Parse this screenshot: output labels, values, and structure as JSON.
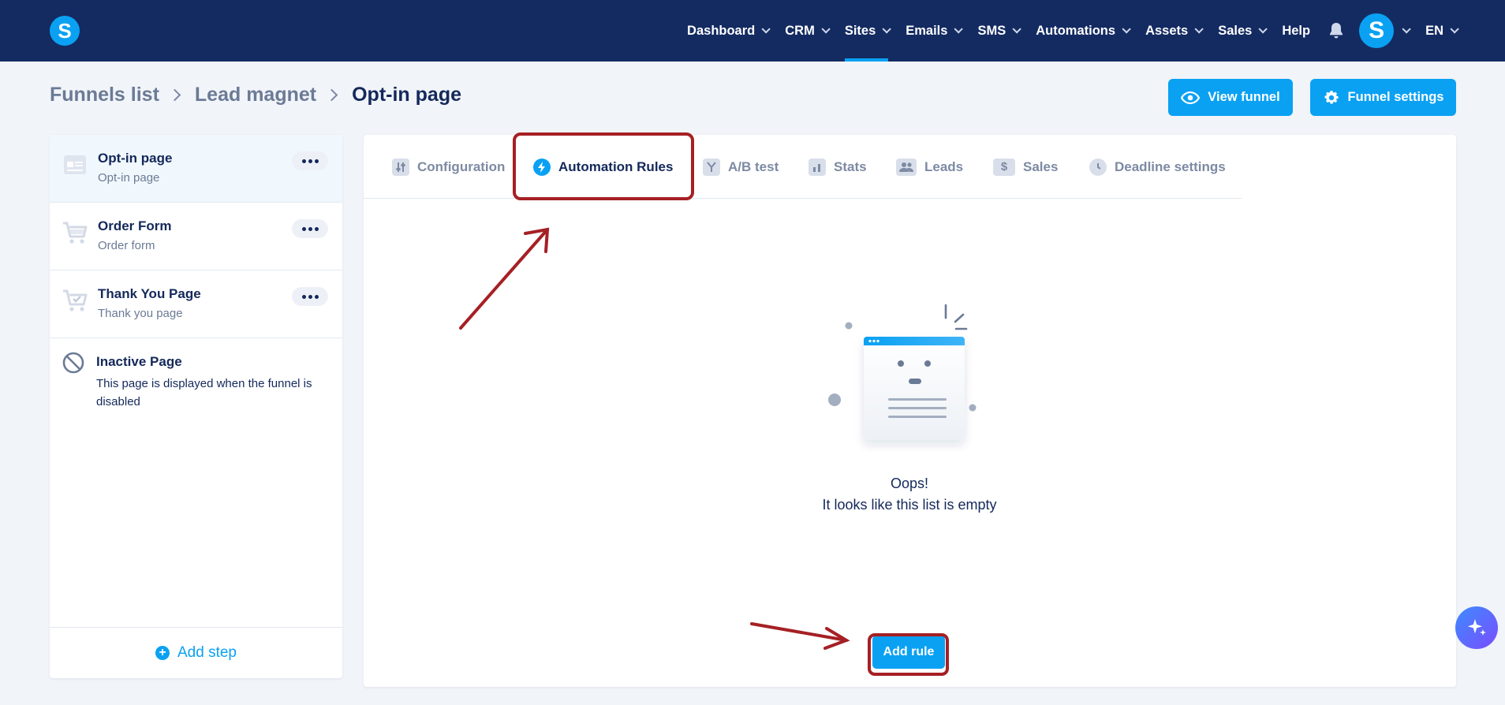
{
  "topnav": {
    "logo_letter": "S",
    "items": [
      {
        "label": "Dashboard",
        "dropdown": true
      },
      {
        "label": "CRM",
        "dropdown": true
      },
      {
        "label": "Sites",
        "dropdown": true,
        "active": true
      },
      {
        "label": "Emails",
        "dropdown": true
      },
      {
        "label": "SMS",
        "dropdown": true
      },
      {
        "label": "Automations",
        "dropdown": true
      },
      {
        "label": "Assets",
        "dropdown": true
      },
      {
        "label": "Sales",
        "dropdown": true
      },
      {
        "label": "Help",
        "dropdown": false
      }
    ],
    "avatar_letter": "S",
    "language": "EN"
  },
  "breadcrumb": {
    "items": [
      "Funnels list",
      "Lead magnet"
    ],
    "current": "Opt-in page"
  },
  "header_buttons": {
    "view_funnel": "View funnel",
    "funnel_settings": "Funnel settings"
  },
  "steps": {
    "items": [
      {
        "title": "Opt-in page",
        "subtitle": "Opt-in page",
        "icon": "page-icon"
      },
      {
        "title": "Order Form",
        "subtitle": "Order form",
        "icon": "cart-icon"
      },
      {
        "title": "Thank You Page",
        "subtitle": "Thank you page",
        "icon": "cart-check-icon"
      }
    ],
    "inactive": {
      "title": "Inactive Page",
      "description": "This page is displayed when the funnel is disabled"
    },
    "add_step": "Add step"
  },
  "tabs": [
    {
      "label": "Configuration",
      "icon": "sliders-icon"
    },
    {
      "label": "Automation Rules",
      "icon": "bolt-icon",
      "active": true
    },
    {
      "label": "A/B test",
      "icon": "split-icon"
    },
    {
      "label": "Stats",
      "icon": "bar-chart-icon"
    },
    {
      "label": "Leads",
      "icon": "users-icon"
    },
    {
      "label": "Sales",
      "icon": "dollar-icon"
    },
    {
      "label": "Deadline settings",
      "icon": "clock-icon"
    }
  ],
  "empty_state": {
    "title": "Oops!",
    "subtitle": "It looks like this list is empty"
  },
  "add_rule": "Add rule",
  "colors": {
    "nav_bg": "#142b62",
    "accent": "#0aa1f3",
    "annotation": "#a52024"
  }
}
